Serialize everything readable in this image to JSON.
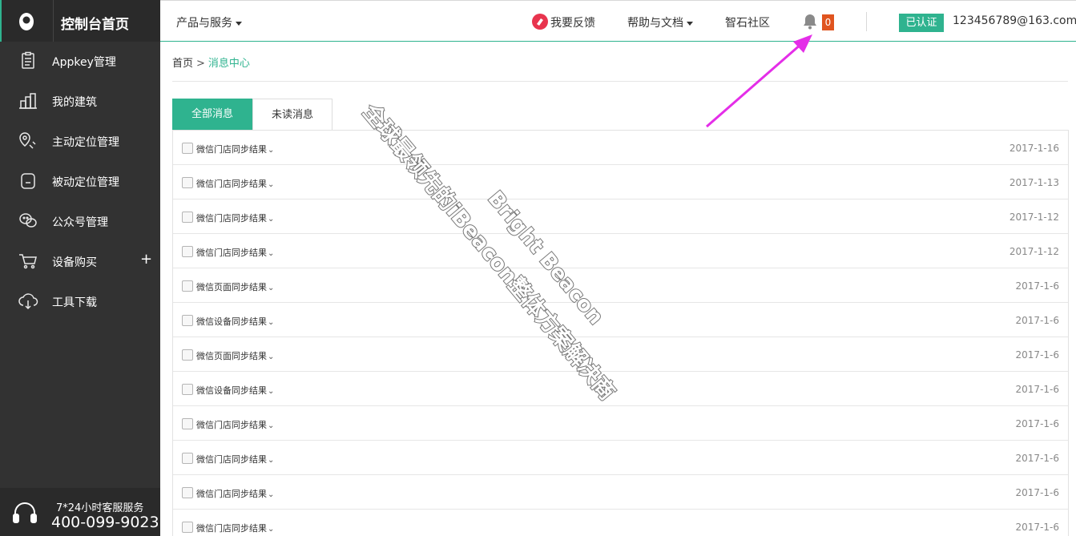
{
  "sidebar": {
    "title": "控制台首页",
    "logo_icon": "eye-logo-icon",
    "items": [
      {
        "label": "Appkey管理",
        "icon": "clipboard-icon"
      },
      {
        "label": "我的建筑",
        "icon": "building-icon"
      },
      {
        "label": "主动定位管理",
        "icon": "location-pin-icon"
      },
      {
        "label": "被动定位管理",
        "icon": "device-icon"
      },
      {
        "label": "公众号管理",
        "icon": "wechat-icon"
      },
      {
        "label": "设备购买",
        "icon": "cart-icon",
        "expand": "+"
      },
      {
        "label": "工具下载",
        "icon": "cloud-download-icon"
      }
    ],
    "service": {
      "label": "7*24小时客服服务",
      "phone": "400-099-9023",
      "icon": "headset-icon"
    }
  },
  "header": {
    "products_menu": "产品与服务",
    "feedback": "我要反馈",
    "help_menu": "帮助与文档",
    "community": "智石社区",
    "notification_count": "0",
    "verified": "已认证",
    "account": "123456789@163.com"
  },
  "breadcrumb": {
    "home": "首页",
    "separator": ">",
    "current": "消息中心"
  },
  "tabs": [
    {
      "label": "全部消息",
      "active": true
    },
    {
      "label": "未读消息",
      "active": false
    }
  ],
  "messages": [
    {
      "subject": "微信门店同步结果",
      "date": "2017-1-16"
    },
    {
      "subject": "微信门店同步结果",
      "date": "2017-1-13"
    },
    {
      "subject": "微信门店同步结果",
      "date": "2017-1-12"
    },
    {
      "subject": "微信门店同步结果",
      "date": "2017-1-12"
    },
    {
      "subject": "微信页面同步结果",
      "date": "2017-1-6"
    },
    {
      "subject": "微信设备同步结果",
      "date": "2017-1-6"
    },
    {
      "subject": "微信页面同步结果",
      "date": "2017-1-6"
    },
    {
      "subject": "微信设备同步结果",
      "date": "2017-1-6"
    },
    {
      "subject": "微信门店同步结果",
      "date": "2017-1-6"
    },
    {
      "subject": "微信门店同步结果",
      "date": "2017-1-6"
    },
    {
      "subject": "微信门店同步结果",
      "date": "2017-1-6"
    },
    {
      "subject": "微信门店同步结果",
      "date": "2017-1-6"
    }
  ],
  "watermark": {
    "line1": "Bright Beacon",
    "line2": "全球最领先的iBeacon整体方案解决商"
  },
  "colors": {
    "accent": "#2fb38f",
    "sidebar_bg": "#323232",
    "badge": "#e0541f",
    "annotation_arrow": "#e42ee8"
  }
}
